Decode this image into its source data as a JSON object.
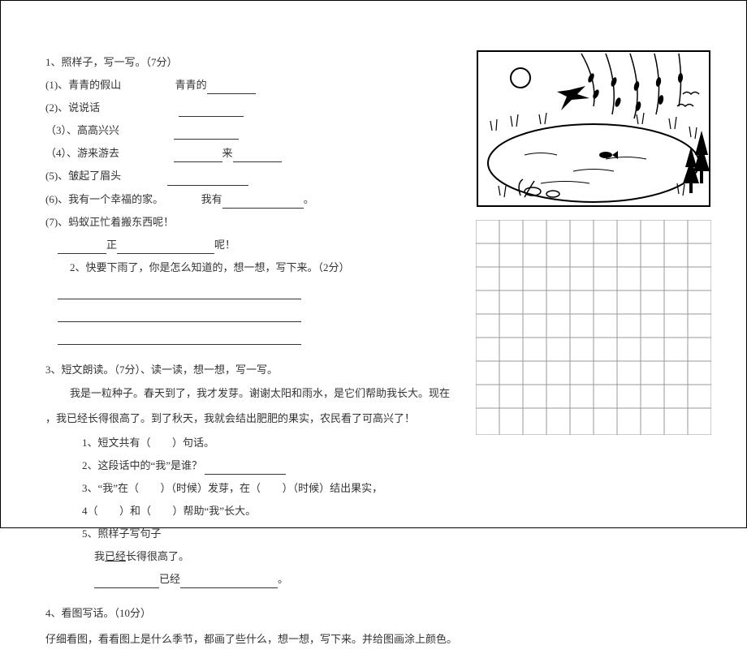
{
  "q1": {
    "title": "1、照样子，写一写。（7分）",
    "i1a": "(1)、青青的假山",
    "i1b": "青青的",
    "i2": "(2)、说说话",
    "i3": "（3）、高高兴兴",
    "i4a": "（4）、游来游去",
    "i4b": "来",
    "i5": "(5)、皱起了眉头",
    "i6a": "(6)、我有一个幸福的家。",
    "i6b": "我有",
    "i6c": "。",
    "i7": "(7)、蚂蚁正忙着搬东西呢！",
    "i7b": "正",
    "i7c": "呢！"
  },
  "q2": {
    "text": "2、快要下雨了，你是怎么知道的，想一想，写下来。（2分）"
  },
  "q3": {
    "title": "3、短文朗读。（7分）、读一读，想一想，写一写。",
    "p1": "我是一粒种子。春天到了，我才发芽。谢谢太阳和雨水，是它们帮助我长大。现在",
    "p2": "，我已经长得很高了。到了秋天，我就会结出肥肥的果实，农民看了可高兴了！",
    "s1a": "1、短文共有（",
    "s1b": "）句话。",
    "s2": "2、这段话中的“我”是谁？",
    "s3a": "3、“我”在（",
    "s3b": "）（时候）发芽，在（",
    "s3c": "）（时候）结出果实，",
    "s4a": "4（",
    "s4b": "）和（",
    "s4c": "）帮助“我”长大。",
    "s5": "5、照样子写句子",
    "s5a_a": "我",
    "s5a_b": "已经",
    "s5a_c": "长得很高了。",
    "s5b": "已经",
    "s5c": "。"
  },
  "q4": {
    "title": "4、看图写话。（10分）",
    "text": "仔细看图，看看图上是什么季节，都画了些什么，想一想，写下来。并给图画涂上颜色。"
  }
}
